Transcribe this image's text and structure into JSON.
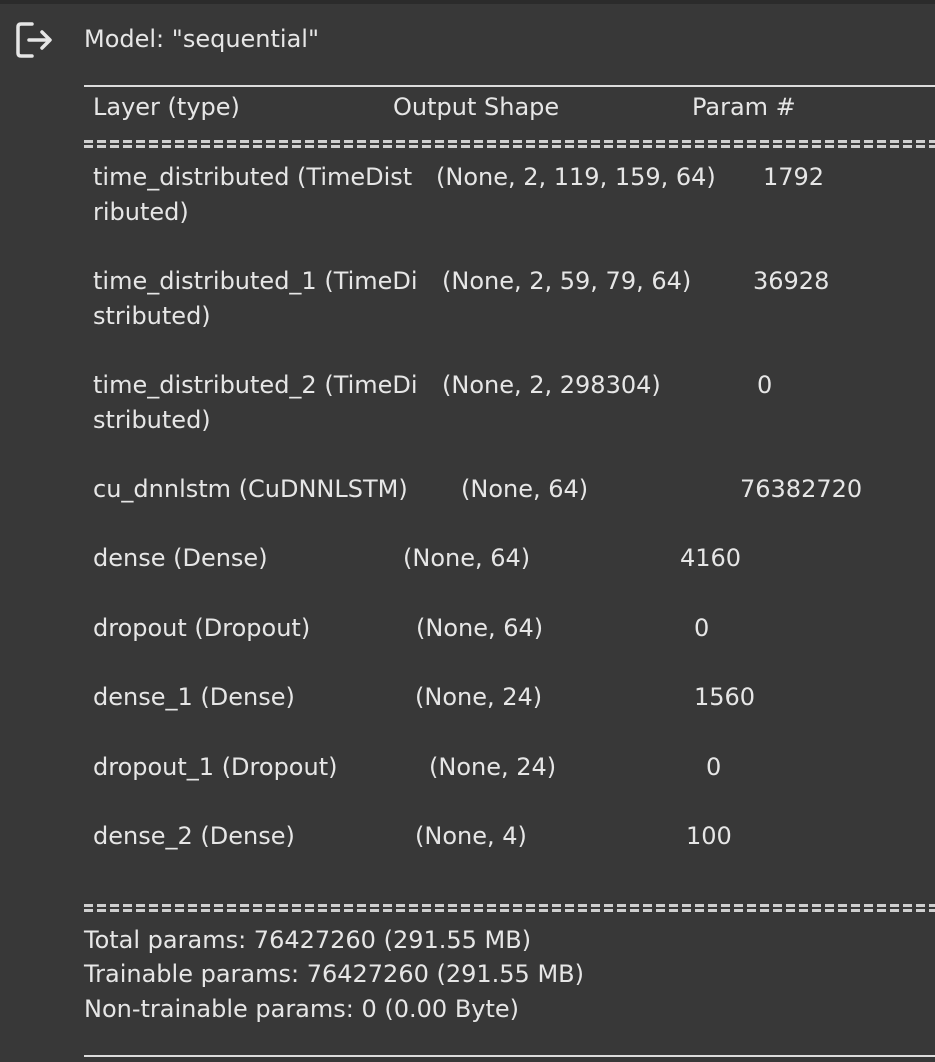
{
  "model_title": "Model: \"sequential\"",
  "columns": {
    "layer": "Layer (type)",
    "output": "Output Shape",
    "params": "Param #"
  },
  "rows": [
    {
      "layer": "time_distributed (TimeDist",
      "layer_wrap": "ributed)",
      "output": "(None, 2, 119, 159, 64)",
      "params": "1792"
    },
    {
      "layer": "time_distributed_1 (TimeDi",
      "layer_wrap": "stributed)",
      "output": "(None, 2, 59, 79, 64)",
      "params": "36928"
    },
    {
      "layer": "time_distributed_2 (TimeDi",
      "layer_wrap": "stributed)",
      "output": "(None, 2, 298304)",
      "params": "0"
    },
    {
      "layer": "cu_dnnlstm (CuDNNLSTM)",
      "output": "(None, 64)",
      "params": "76382720"
    },
    {
      "layer": "dense (Dense)",
      "output": "(None, 64)",
      "params": "4160"
    },
    {
      "layer": "dropout (Dropout)",
      "output": "(None, 64)",
      "params": "0"
    },
    {
      "layer": "dense_1 (Dense)",
      "output": "(None, 24)",
      "params": "1560"
    },
    {
      "layer": "dropout_1 (Dropout)",
      "output": "(None, 24)",
      "params": "0"
    },
    {
      "layer": "dense_2 (Dense)",
      "output": "(None, 4)",
      "params": "100"
    }
  ],
  "summary": {
    "total": "Total params: 76427260 (291.55 MB)",
    "trainable": "Trainable params: 76427260 (291.55 MB)",
    "non_trainable": "Non-trainable params: 0 (0.00 Byte)"
  },
  "icons": {
    "output_action": "output-clear-icon"
  }
}
